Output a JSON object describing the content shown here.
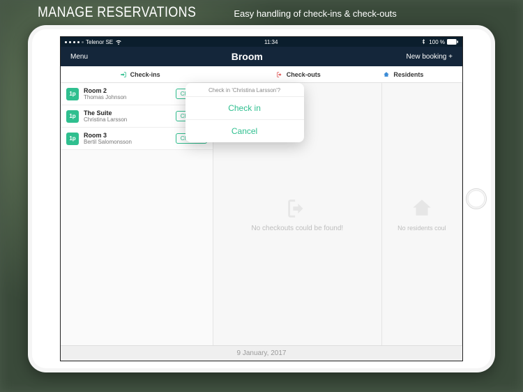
{
  "marketing": {
    "title": "MANAGE RESERVATIONS",
    "subtitle": "Easy handling of check-ins & check-outs"
  },
  "statusbar": {
    "carrier": "Telenor SE",
    "time": "11:34",
    "battery": "100 %"
  },
  "nav": {
    "menu": "Menu",
    "title": "Broom",
    "new_booking": "New booking +"
  },
  "tabs": {
    "checkins": "Check-ins",
    "checkouts": "Check-outs",
    "residents": "Residents"
  },
  "reservations": [
    {
      "badge": "1p",
      "room": "Room 2",
      "guest": "Thomas Johnson",
      "action": "Check in"
    },
    {
      "badge": "1p",
      "room": "The Suite",
      "guest": "Christina Larsson",
      "action": "Check in"
    },
    {
      "badge": "1p",
      "room": "Room 3",
      "guest": "Bertil Salomonsson",
      "action": "Check in"
    }
  ],
  "empty": {
    "checkouts": "No checkouts could be found!",
    "residents": "No residents coul"
  },
  "popover": {
    "title": "Check in 'Christina Larsson'?",
    "confirm": "Check in",
    "cancel": "Cancel"
  },
  "footer": {
    "date": "9 January, 2017"
  },
  "colors": {
    "navbar": "#14263a",
    "accent": "#2fbf8f",
    "checkout_icon": "#e05b5b",
    "resident_icon": "#3b8bd6"
  }
}
